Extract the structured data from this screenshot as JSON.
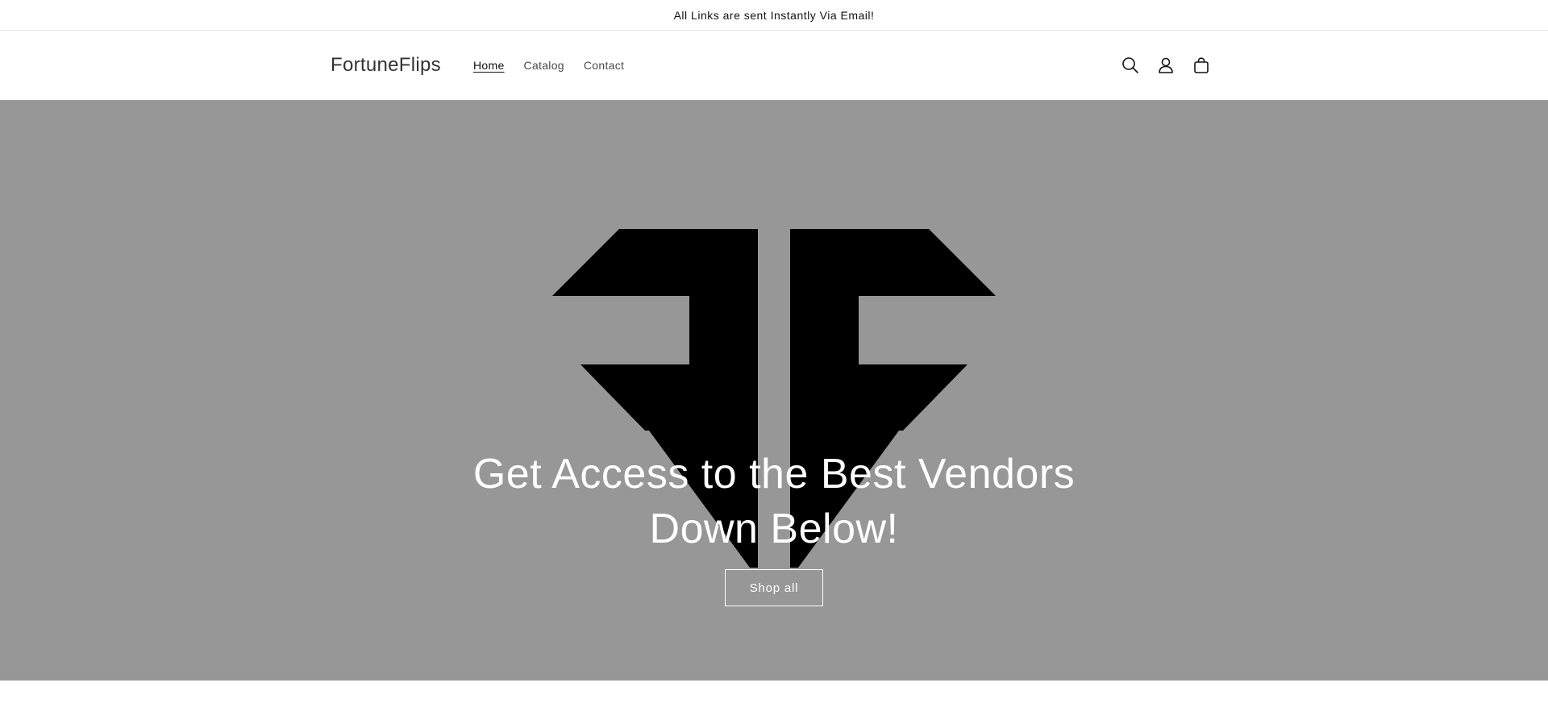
{
  "announcement": {
    "text": "All Links are sent Instantly Via Email!"
  },
  "header": {
    "logo": "FortuneFlips",
    "nav": [
      {
        "label": "Home",
        "active": true
      },
      {
        "label": "Catalog",
        "active": false
      },
      {
        "label": "Contact",
        "active": false
      }
    ],
    "icons": [
      "search-icon",
      "account-icon",
      "cart-icon"
    ]
  },
  "hero": {
    "title": "Get Access to the Best Vendors Down Below!",
    "button_label": "Shop all",
    "background_color": "#979797",
    "logo_color": "#000000"
  }
}
